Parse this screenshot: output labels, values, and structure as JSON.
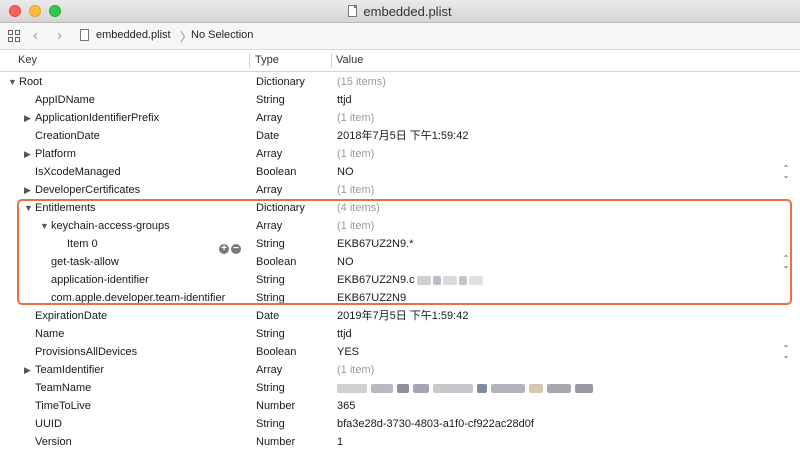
{
  "window": {
    "title": "embedded.plist"
  },
  "navbar": {
    "crumb_file": "embedded.plist",
    "crumb_selection": "No Selection",
    "back_glyph": "‹",
    "forward_glyph": "›",
    "separator": "〉"
  },
  "columns": {
    "key": "Key",
    "type": "Type",
    "value": "Value"
  },
  "rows": [
    {
      "key": "Root",
      "type": "Dictionary",
      "value": "(15 items)",
      "indent": 0,
      "expand": "open",
      "dim": true
    },
    {
      "key": "AppIDName",
      "type": "String",
      "value": "ttjd",
      "indent": 1,
      "expand": "none",
      "dim": false
    },
    {
      "key": "ApplicationIdentifierPrefix",
      "type": "Array",
      "value": "(1 item)",
      "indent": 1,
      "expand": "closed",
      "dim": true
    },
    {
      "key": "CreationDate",
      "type": "Date",
      "value": "2018年7月5日 下午1:59:42",
      "indent": 1,
      "expand": "none",
      "dim": false
    },
    {
      "key": "Platform",
      "type": "Array",
      "value": "(1 item)",
      "indent": 1,
      "expand": "closed",
      "dim": true
    },
    {
      "key": "IsXcodeManaged",
      "type": "Boolean",
      "value": "NO",
      "indent": 1,
      "expand": "none",
      "dim": false,
      "stepper": true
    },
    {
      "key": "DeveloperCertificates",
      "type": "Array",
      "value": "(1 item)",
      "indent": 1,
      "expand": "closed",
      "dim": true
    },
    {
      "key": "Entitlements",
      "type": "Dictionary",
      "value": "(4 items)",
      "indent": 1,
      "expand": "open",
      "dim": true
    },
    {
      "key": "keychain-access-groups",
      "type": "Array",
      "value": "(1 item)",
      "indent": 2,
      "expand": "open",
      "dim": true
    },
    {
      "key": "Item 0",
      "type": "String",
      "value": "EKB67UZ2N9.*",
      "indent": 3,
      "expand": "none",
      "dim": false,
      "addremove": true
    },
    {
      "key": "get-task-allow",
      "type": "Boolean",
      "value": "NO",
      "indent": 2,
      "expand": "none",
      "dim": false,
      "stepper": true
    },
    {
      "key": "application-identifier",
      "type": "String",
      "value": "EKB67UZ2N9.c",
      "indent": 2,
      "expand": "none",
      "dim": false,
      "redacted": "short"
    },
    {
      "key": "com.apple.developer.team-identifier",
      "type": "String",
      "value": "EKB67UZ2N9",
      "indent": 2,
      "expand": "none",
      "dim": false
    },
    {
      "key": "ExpirationDate",
      "type": "Date",
      "value": "2019年7月5日 下午1:59:42",
      "indent": 1,
      "expand": "none",
      "dim": false
    },
    {
      "key": "Name",
      "type": "String",
      "value": "ttjd",
      "indent": 1,
      "expand": "none",
      "dim": false
    },
    {
      "key": "ProvisionsAllDevices",
      "type": "Boolean",
      "value": "YES",
      "indent": 1,
      "expand": "none",
      "dim": false,
      "stepper": true
    },
    {
      "key": "TeamIdentifier",
      "type": "Array",
      "value": "(1 item)",
      "indent": 1,
      "expand": "closed",
      "dim": true
    },
    {
      "key": "TeamName",
      "type": "String",
      "value": "",
      "indent": 1,
      "expand": "none",
      "dim": false,
      "redacted": "long"
    },
    {
      "key": "TimeToLive",
      "type": "Number",
      "value": "365",
      "indent": 1,
      "expand": "none",
      "dim": false
    },
    {
      "key": "UUID",
      "type": "String",
      "value": "bfa3e28d-3730-4803-a1f0-cf922ac28d0f",
      "indent": 1,
      "expand": "none",
      "dim": false
    },
    {
      "key": "Version",
      "type": "Number",
      "value": "1",
      "indent": 1,
      "expand": "none",
      "dim": false
    }
  ],
  "colors": {
    "highlight": "#ef6d3f",
    "dim_text": "#9a9a9a"
  },
  "icons": {
    "expanded": "triangle-down-icon",
    "collapsed": "triangle-right-icon",
    "stepper": "up-down-stepper-icon",
    "add": "plus-circle-icon",
    "remove": "minus-circle-icon"
  }
}
